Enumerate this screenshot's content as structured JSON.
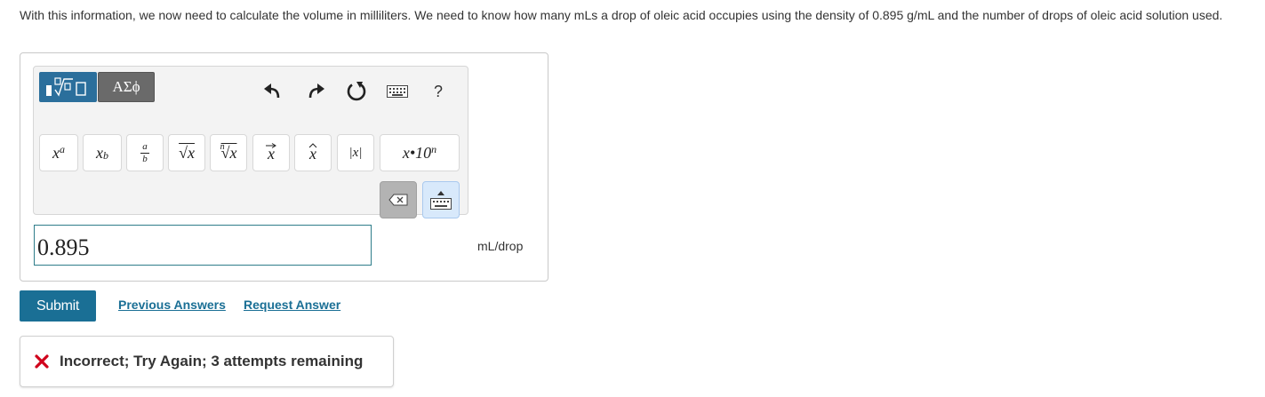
{
  "question": {
    "text": "With this information, we now need to calculate the volume in milliliters.  We need to know how many mLs a drop of oleic acid occupies using the density of 0.895 g/mL and the number of drops of oleic acid solution used."
  },
  "toolbar": {
    "symbols_tab_label": "ΑΣϕ",
    "help_label": "?",
    "keys": {
      "superscript_base": "x",
      "superscript_exp": "a",
      "subscript_base": "x",
      "subscript_sub": "b",
      "fraction_num": "a",
      "fraction_den": "b",
      "sqrt_label": "√x",
      "nthroot_index": "n",
      "nthroot_label": "√x",
      "vector_label": "x",
      "hat_label": "x",
      "abs_label": "|x|",
      "sci_label": "x•10",
      "sci_exp": "n"
    }
  },
  "answer": {
    "value": "0.895",
    "unit": "mL/drop"
  },
  "actions": {
    "submit_label": "Submit",
    "previous_answers_label": "Previous Answers",
    "request_answer_label": "Request Answer"
  },
  "feedback": {
    "text": "Incorrect; Try Again; 3 attempts remaining",
    "status_color": "#d0021b"
  },
  "colors": {
    "accent": "#1a6f95",
    "input_border": "#2e7d8a"
  }
}
